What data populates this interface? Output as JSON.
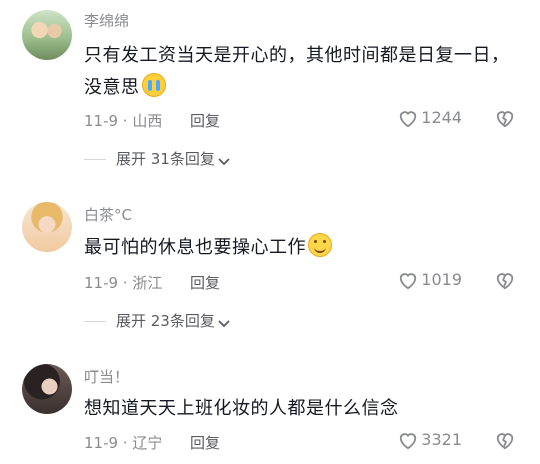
{
  "comments": [
    {
      "username": "李绵绵",
      "content": "只有发工资当天是开心的，其他时间都是日复一日，没意思",
      "emoji": "crying-emoji",
      "meta": "11-9 · 山西",
      "reply_label": "回复",
      "likes": "1244",
      "expand_label": "展开 31条回复"
    },
    {
      "username": "白茶°C",
      "content": "最可怕的休息也要操心工作",
      "emoji": "smiling-emoji",
      "meta": "11-9 · 浙江",
      "reply_label": "回复",
      "likes": "1019",
      "expand_label": "展开 23条回复"
    },
    {
      "username": "叮当！",
      "content": "想知道天天上班化妆的人都是什么信念",
      "meta": "11-9 · 辽宁",
      "reply_label": "回复",
      "likes": "3321"
    }
  ],
  "colors": {
    "text": "#161823",
    "muted": "#8a8b91"
  }
}
